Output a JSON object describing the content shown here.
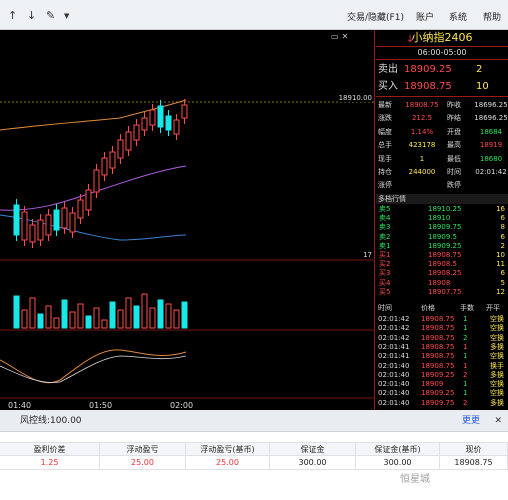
{
  "toolbar": {
    "icons": [
      "arrow-up-icon",
      "arrow-down-icon",
      "pencil-icon",
      "dropdown-caret-icon"
    ],
    "menu": [
      "交易/隐藏(F1)",
      "账户",
      "系统",
      "帮助"
    ]
  },
  "chart": {
    "price_line_label": "18910.00",
    "right_axis_label": "17",
    "time_labels": [
      "01:40",
      "01:50",
      "02:00"
    ]
  },
  "panel": {
    "title": "小纳指2406",
    "time_range": "06:00-05:00",
    "ask_label": "卖出",
    "ask_price": "18909.25",
    "ask_vol": "2",
    "bid_label": "买入",
    "bid_price": "18908.75",
    "bid_vol": "10",
    "stats_left": [
      {
        "label": "最新",
        "value": "18908.75",
        "color": "red"
      },
      {
        "label": "涨跌",
        "value": "212.5",
        "color": "red"
      },
      {
        "label": "幅度",
        "value": "1.14%",
        "color": "red"
      },
      {
        "label": "总手",
        "value": "423178",
        "color": "yellow"
      },
      {
        "label": "现手",
        "value": "1",
        "color": "yellow"
      },
      {
        "label": "持仓",
        "value": "244000",
        "color": "yellow"
      },
      {
        "label": "涨停",
        "value": "",
        "color": "white"
      }
    ],
    "stats_right": [
      {
        "label": "昨收",
        "value": "18696.25",
        "color": "white"
      },
      {
        "label": "昨结",
        "value": "18696.25",
        "color": "white"
      },
      {
        "label": "开盘",
        "value": "18684",
        "color": "green"
      },
      {
        "label": "最高",
        "value": "18919",
        "color": "red"
      },
      {
        "label": "最低",
        "value": "18680",
        "color": "green"
      },
      {
        "label": "时间",
        "value": "02:01:42",
        "color": "white"
      },
      {
        "label": "跌停",
        "value": "",
        "color": "white"
      }
    ],
    "ladder_title": "多档行情",
    "ladder": [
      {
        "name": "卖5",
        "price": "18910.25",
        "qty": "16",
        "side": "sell"
      },
      {
        "name": "卖4",
        "price": "18910",
        "qty": "6",
        "side": "sell"
      },
      {
        "name": "卖3",
        "price": "18909.75",
        "qty": "8",
        "side": "sell"
      },
      {
        "name": "卖2",
        "price": "18909.5",
        "qty": "6",
        "side": "sell"
      },
      {
        "name": "卖1",
        "price": "18909.25",
        "qty": "2",
        "side": "sell"
      },
      {
        "name": "买1",
        "price": "18908.75",
        "qty": "10",
        "side": "buy"
      },
      {
        "name": "买2",
        "price": "18908.5",
        "qty": "11",
        "side": "buy"
      },
      {
        "name": "买3",
        "price": "18908.25",
        "qty": "6",
        "side": "buy"
      },
      {
        "name": "买4",
        "price": "18908",
        "qty": "5",
        "side": "buy"
      },
      {
        "name": "买5",
        "price": "18907.75",
        "qty": "12",
        "side": "buy"
      }
    ],
    "trade_headers": [
      "时间",
      "价格",
      "手数",
      "开平"
    ],
    "trades": [
      {
        "time": "02:01:42",
        "price": "18908.75",
        "qty": "1",
        "type": "空换",
        "qc": "green"
      },
      {
        "time": "02:01:42",
        "price": "18908.75",
        "qty": "1",
        "type": "空换",
        "qc": "green"
      },
      {
        "time": "02:01:42",
        "price": "18908.75",
        "qty": "2",
        "type": "空换",
        "qc": "green"
      },
      {
        "time": "02:01:41",
        "price": "18908.75",
        "qty": "1",
        "type": "多换",
        "qc": "red"
      },
      {
        "time": "02:01:41",
        "price": "18908.75",
        "qty": "1",
        "type": "空换",
        "qc": "green"
      },
      {
        "time": "02:01:40",
        "price": "18908.75",
        "qty": "1",
        "type": "换手",
        "qc": "red"
      },
      {
        "time": "02:01:40",
        "price": "18909.25",
        "qty": "2",
        "type": "多换",
        "qc": "red"
      },
      {
        "time": "02:01:40",
        "price": "18909",
        "qty": "1",
        "type": "空换",
        "qc": "green"
      },
      {
        "time": "02:01:40",
        "price": "18909.25",
        "qty": "1",
        "type": "空换",
        "qc": "green"
      },
      {
        "time": "02:01:40",
        "price": "18909.75",
        "qty": "2",
        "type": "多换",
        "qc": "red"
      }
    ]
  },
  "bottom": {
    "risk_label": "风控线:100.00",
    "risk_link": "更更",
    "columns": [
      "盈利价差",
      "浮动盈亏",
      "浮动盈亏(基币)",
      "保证金",
      "保证金(基币)",
      "现价"
    ],
    "row": [
      "1.25",
      "25.00",
      "25.00",
      "300.00",
      "300.00",
      "18908.75"
    ],
    "watermark": "恒星城"
  }
}
